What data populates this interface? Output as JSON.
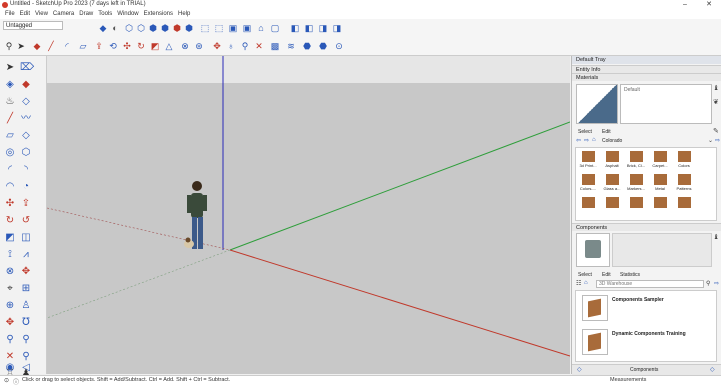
{
  "window": {
    "title": "Untitled - SketchUp Pro 2023 (7 days left in TRIAL)",
    "minimize": "–",
    "close": "✕"
  },
  "menu": [
    "File",
    "Edit",
    "View",
    "Camera",
    "Draw",
    "Tools",
    "Window",
    "Extensions",
    "Help"
  ],
  "toolbar": {
    "tag_select": "Untagged"
  },
  "tray": {
    "title": "Default Tray",
    "entity_info": "Entity Info",
    "materials": {
      "header": "Materials",
      "current_name": "Default",
      "tab_select": "Select",
      "tab_edit": "Edit",
      "library": "Colorado",
      "items": [
        "3d Print...",
        "Asphalt",
        "Brick, Cl...",
        "Carpet...",
        "Colors",
        "Colors-...",
        "Glass a...",
        "Markers...",
        "Metal",
        "Patterns",
        "",
        "",
        "",
        "",
        ""
      ]
    },
    "components": {
      "header": "Components",
      "tab_select": "Select",
      "tab_edit": "Edit",
      "tab_statistics": "Statistics",
      "search_placeholder": "3D Warehouse",
      "items": [
        "Components Sampler",
        "Dynamic Components Training"
      ],
      "footer": "Components"
    }
  },
  "status": {
    "text": "Click or drag to select objects. Shift = Add/Subtract. Ctrl = Add. Shift + Ctrl = Subtract.",
    "measurements": "Measurements"
  },
  "colors": {
    "axis_red": "#c0392b",
    "axis_green": "#2e9e3a",
    "axis_blue": "#2a2ab8",
    "viewport_ground": "#c8c8c8",
    "viewport_sky": "#e6e6e6"
  }
}
